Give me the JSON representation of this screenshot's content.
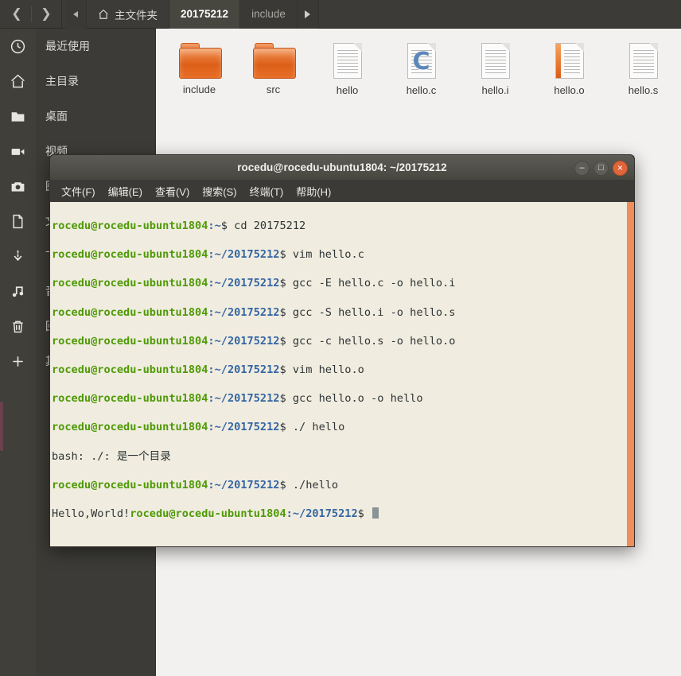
{
  "window": {
    "nav": {
      "back_icon": "chevron-left-icon",
      "forward_icon": "chevron-right-icon"
    },
    "breadcrumbs": [
      {
        "label": "主文件夹",
        "icon": "home-icon",
        "state": "normal"
      },
      {
        "label": "20175212",
        "state": "active"
      },
      {
        "label": "include",
        "state": "dim"
      }
    ],
    "breadcrumb_more_icon": "triangle-right-icon",
    "breadcrumb_prev_icon": "triangle-left-icon"
  },
  "launcher": {
    "items": [
      {
        "name": "recent",
        "icon": "clock-icon"
      },
      {
        "name": "home",
        "icon": "home-icon"
      },
      {
        "name": "desktop",
        "icon": "folder-icon"
      },
      {
        "name": "videos",
        "icon": "video-icon"
      },
      {
        "name": "pictures",
        "icon": "camera-icon"
      },
      {
        "name": "documents",
        "icon": "document-icon"
      },
      {
        "name": "downloads",
        "icon": "download-icon"
      },
      {
        "name": "music",
        "icon": "music-icon"
      },
      {
        "name": "trash",
        "icon": "trash-icon"
      },
      {
        "name": "other-locations",
        "icon": "plus-icon"
      }
    ]
  },
  "sidebar": {
    "items": [
      {
        "label": "最近使用"
      },
      {
        "label": "主目录"
      },
      {
        "label": "桌面"
      },
      {
        "label": "视频"
      },
      {
        "label": "图片"
      },
      {
        "label": "文档"
      },
      {
        "label": "下载"
      },
      {
        "label": "音乐"
      },
      {
        "label": "回收站"
      },
      {
        "label": "其他位置"
      }
    ]
  },
  "files": [
    {
      "name": "include",
      "type": "folder"
    },
    {
      "name": "src",
      "type": "folder"
    },
    {
      "name": "hello",
      "type": "document"
    },
    {
      "name": "hello.c",
      "type": "c-source"
    },
    {
      "name": "hello.i",
      "type": "document"
    },
    {
      "name": "hello.o",
      "type": "object"
    },
    {
      "name": "hello.s",
      "type": "document"
    }
  ],
  "terminal": {
    "title": "rocedu@rocedu-ubuntu1804: ~/20175212",
    "menu": [
      "文件(F)",
      "编辑(E)",
      "查看(V)",
      "搜索(S)",
      "终端(T)",
      "帮助(H)"
    ],
    "window_buttons": {
      "minimize": "–",
      "maximize": "□",
      "close": "×"
    },
    "user_host": "rocedu@rocedu-ubuntu1804",
    "lines": [
      {
        "type": "prompt",
        "path": ":~",
        "sigil": "$ ",
        "command": "cd 20175212"
      },
      {
        "type": "prompt",
        "path": ":~/20175212",
        "sigil": "$ ",
        "command": "vim hello.c"
      },
      {
        "type": "prompt",
        "path": ":~/20175212",
        "sigil": "$ ",
        "command": "gcc -E hello.c -o hello.i"
      },
      {
        "type": "prompt",
        "path": ":~/20175212",
        "sigil": "$ ",
        "command": "gcc -S hello.i -o hello.s"
      },
      {
        "type": "prompt",
        "path": ":~/20175212",
        "sigil": "$ ",
        "command": "gcc -c hello.s -o hello.o"
      },
      {
        "type": "prompt",
        "path": ":~/20175212",
        "sigil": "$ ",
        "command": "vim hello.o"
      },
      {
        "type": "prompt",
        "path": ":~/20175212",
        "sigil": "$ ",
        "command": "gcc hello.o -o hello"
      },
      {
        "type": "prompt",
        "path": ":~/20175212",
        "sigil": "$ ",
        "command": "./ hello"
      },
      {
        "type": "output",
        "text": "bash: ./: 是一个目录"
      },
      {
        "type": "prompt",
        "path": ":~/20175212",
        "sigil": "$ ",
        "command": "./hello"
      },
      {
        "type": "output_prompt",
        "output": "Hello,World!",
        "path": ":~/20175212",
        "sigil": "$ ",
        "cursor": true
      }
    ]
  },
  "colors": {
    "terminal_bg": "#f0ecdf",
    "prompt_green": "#4e9a06",
    "path_blue": "#3465a4",
    "scrollbar_orange": "#ef8e5a",
    "folder_orange": "#dd5f18",
    "close_red": "#e0653a"
  }
}
